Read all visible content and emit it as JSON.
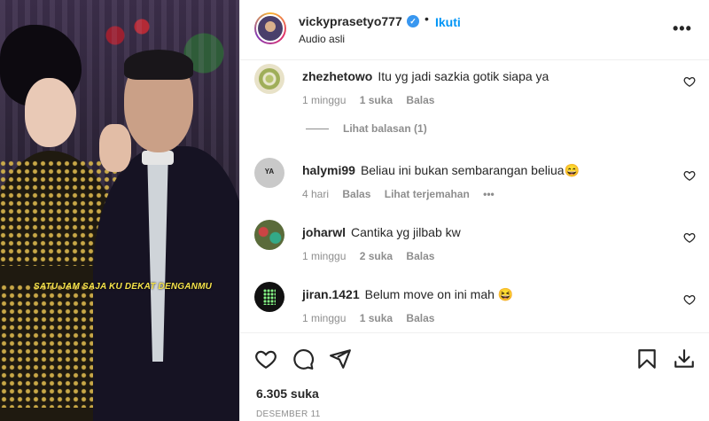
{
  "post": {
    "username": "vickyprasetyo777",
    "follow_label": "Ikuti",
    "separator": "•",
    "audio": "Audio asli",
    "more": "•••",
    "verified_glyph": "✓"
  },
  "video": {
    "caption": "SATU JAM SAJA KU DEKAT DENGANMU"
  },
  "comments": [
    {
      "username": "zhezhetowo",
      "text": "Itu yg jadi sazkia gotik siapa ya",
      "time": "1 minggu",
      "likes": "1 suka",
      "reply": "Balas",
      "view_replies": "Lihat balasan (1)"
    },
    {
      "username": "halymi99",
      "text": "Beliau ini bukan sembarangan beliua😄",
      "time": "4 hari",
      "reply": "Balas",
      "translate": "Lihat terjemahan",
      "options": "•••"
    },
    {
      "username": "joharwl",
      "text": "Cantika yg jilbab kw",
      "time": "1 minggu",
      "likes": "2 suka",
      "reply": "Balas"
    },
    {
      "username": "jiran.1421",
      "text": "Belum move on ini mah 😆",
      "time": "1 minggu",
      "likes": "1 suka",
      "reply": "Balas"
    }
  ],
  "footer": {
    "likes": "6.305 suka",
    "date": "DESEMBER 11"
  },
  "icons": [
    "heart-icon",
    "comment-icon",
    "share-icon",
    "bookmark-icon",
    "download-icon"
  ]
}
